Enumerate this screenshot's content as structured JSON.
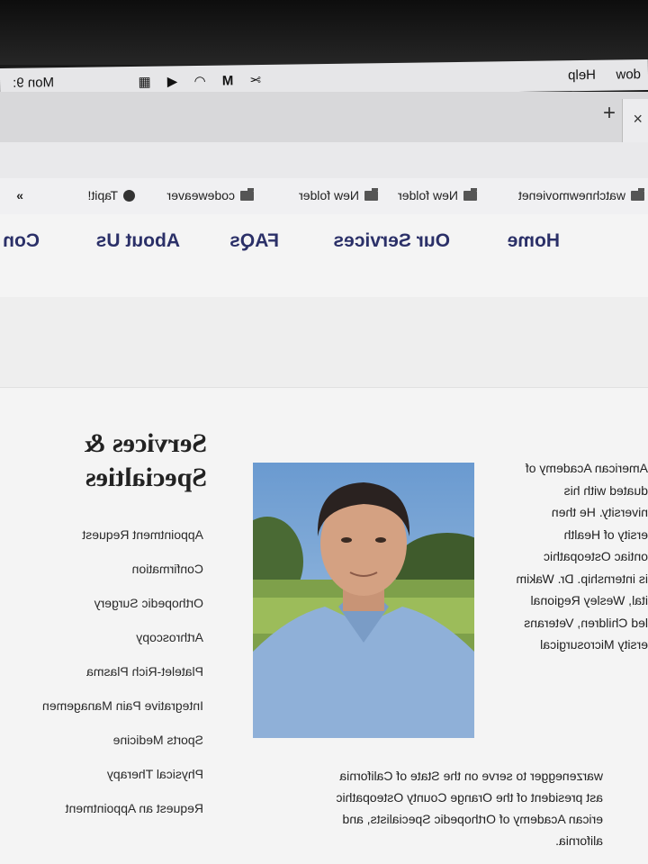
{
  "menubar": {
    "items": [
      "Help",
      "dow",
      "Mon 9:"
    ]
  },
  "browser": {
    "new_tab": "+",
    "close_tab": "×"
  },
  "bookmarks": {
    "items": [
      "watchnewmovienet",
      "New folder",
      "New folder",
      "codeweaver",
      "Tapit!"
    ],
    "more": "»"
  },
  "nav": {
    "items": [
      "Home",
      "Our Services",
      "FAQs",
      "About Us",
      "Con"
    ]
  },
  "bio_top": {
    "lines": [
      "American Academy of",
      "duated with his",
      "niversity. He then",
      "ersity of Health",
      "ontiac Osteopathic",
      "is internship. Dr. Wakim",
      "ital, Wesley Regional",
      "led Children, Veterans",
      "ersity Microsurgical"
    ]
  },
  "sidebar": {
    "title": "Services & Specialties",
    "links": [
      "Appointment Request",
      "Confirmation",
      "Orthopedic Surgery",
      "Arthroscopy",
      "Platelet-Rich Plasma",
      "Integrative Pain Managemen",
      "Sports Medicine",
      "Physical Therapy",
      "Request an Appointment"
    ]
  },
  "bio_bottom": {
    "lines": [
      "warzenegger to serve on the State of California",
      "ast president of the Orange County Osteopathic",
      "erican Academy of Orthopedic Specialists, and",
      "alifornia."
    ]
  }
}
